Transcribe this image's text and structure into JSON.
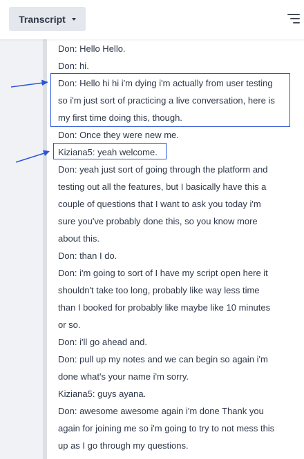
{
  "header": {
    "tab_label": "Transcript",
    "filter_icon": "filter-lines-icon"
  },
  "transcript": {
    "lines": [
      "Don: Hello Hello.",
      "Don: hi.",
      "Don: Hello hi hi i'm dying i'm actually from user testing",
      "so i'm just sort of practicing a live conversation, here is",
      "my first time doing this, though.",
      "Don: Once they were new me.",
      "Kiziana5: yeah welcome.",
      "Don: yeah just sort of going through the platform and",
      "testing out all the features, but I basically have this a",
      "couple of questions that I want to ask you today i'm",
      "sure you've probably done this, so you know more",
      "about this.",
      "Don: than I do.",
      "Don: i'm going to sort of I have my script open here it",
      "shouldn't take too long, probably like way less time",
      "than I booked for probably like maybe like 10 minutes",
      "or so.",
      "Don: i'll go ahead and.",
      "Don: pull up my notes and we can begin so again i'm",
      "done what's your name i'm sorry.",
      "Kiziana5: guys ayana.",
      "Don: awesome awesome again i'm done Thank you",
      "again for joining me so i'm going to try to not mess this",
      "up as I go through my questions."
    ]
  },
  "annotations": {
    "color": "#2b54d6"
  }
}
